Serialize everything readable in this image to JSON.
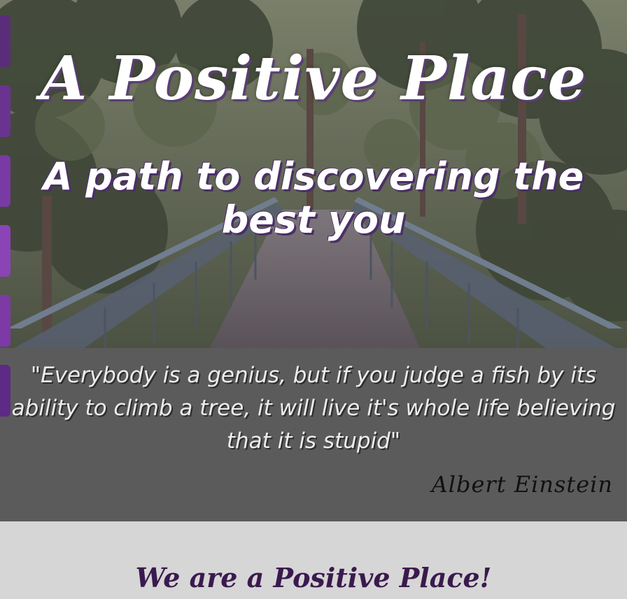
{
  "hero": {
    "title": "A Positive Place",
    "subtitle": "A path to discovering the best you"
  },
  "quote": {
    "text": "\"Everybody is a genius, but if you judge a fish by its ability to climb a tree, it will live it's whole life believing that it is stupid\"",
    "author": "Albert Einstein"
  },
  "section": {
    "heading": "We are a Positive Place!"
  },
  "side_tabs": [
    "#5a2d7a",
    "#6a3390",
    "#7a3aa3",
    "#8a44b5",
    "#7d3aa6",
    "#5d2a85"
  ],
  "colors": {
    "accent_purple": "#5a3f72",
    "quote_band": "#5b5b5b",
    "page_background": "#d6d6d6",
    "heading_text": "#3a1a4e"
  },
  "icons": {
    "hero_image": "forest-bridge-photo"
  }
}
